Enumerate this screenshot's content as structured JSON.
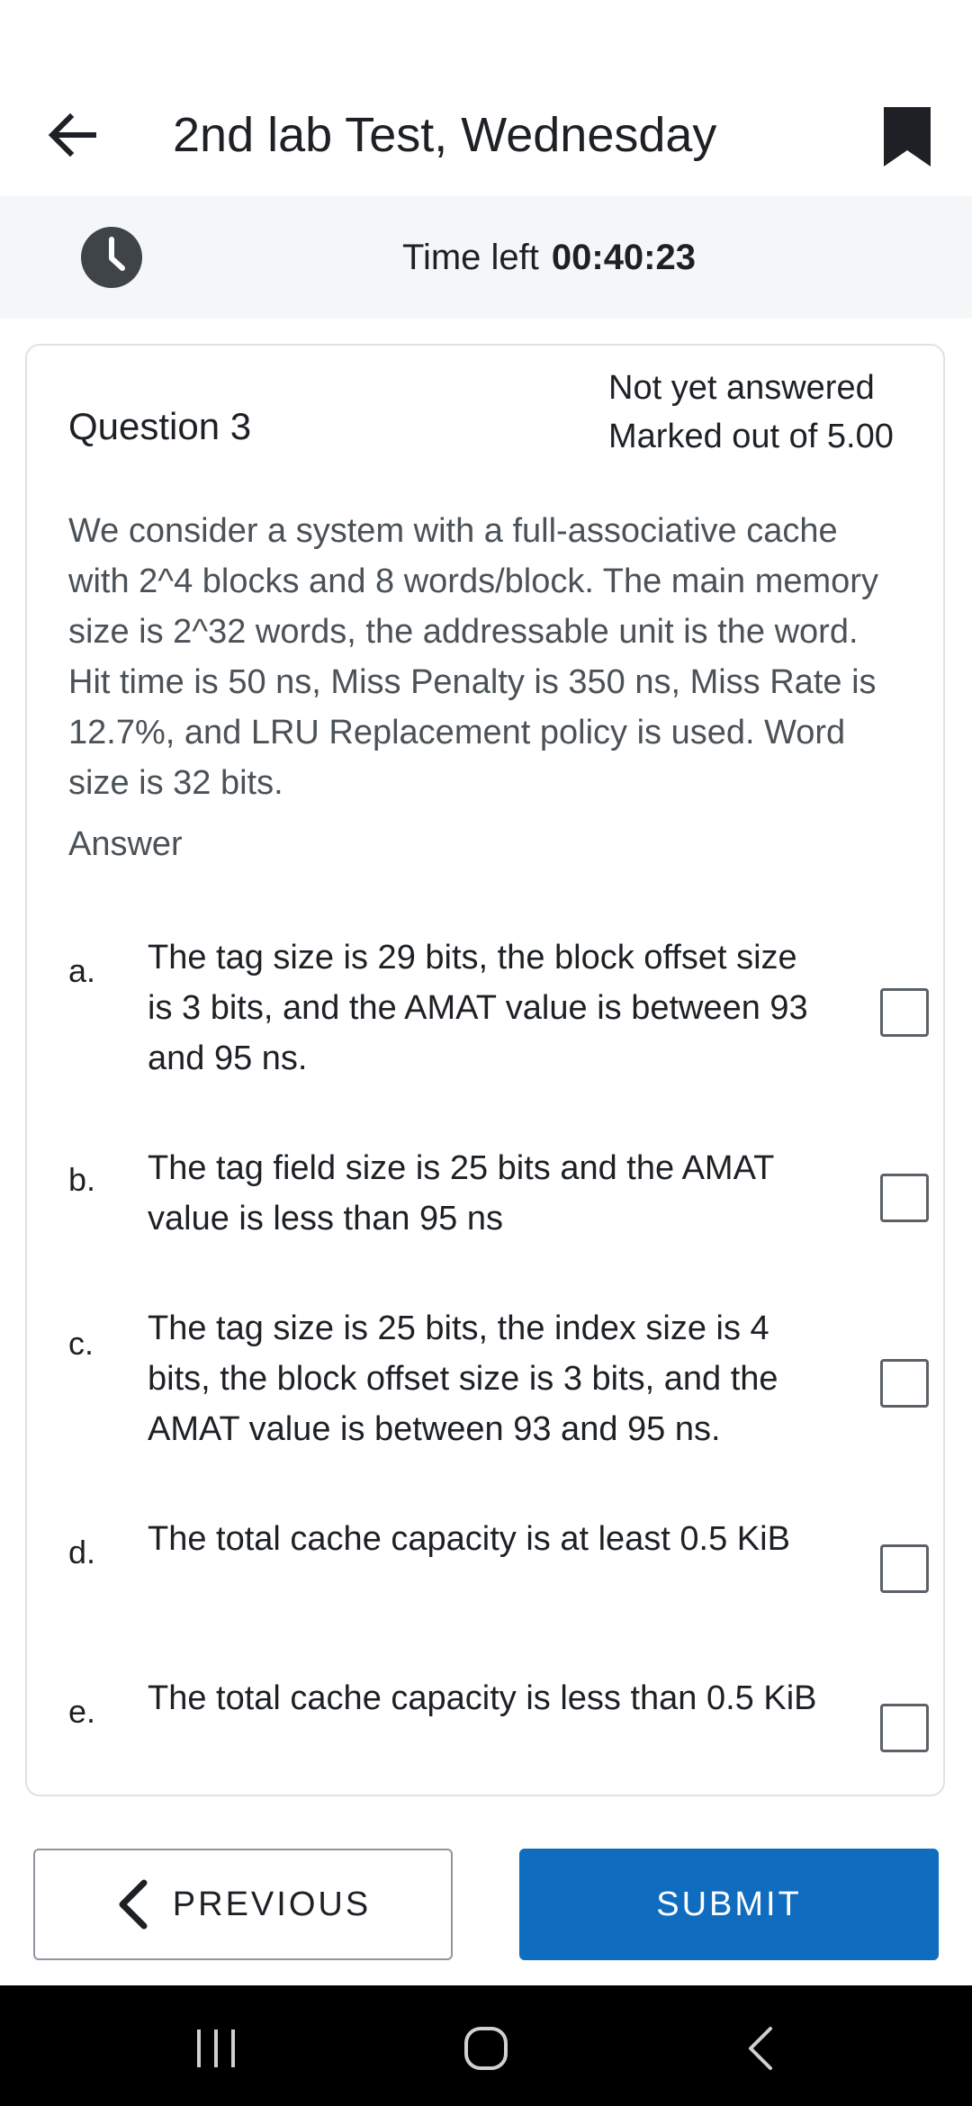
{
  "header": {
    "title": "2nd lab Test, Wednesday",
    "back_icon": "arrow-left-icon",
    "bookmark_icon": "bookmark-icon"
  },
  "timer": {
    "label": "Time left",
    "value": "00:40:23",
    "icon": "clock-icon"
  },
  "question": {
    "number": "Question 3",
    "status_line1": "Not yet answered",
    "status_line2": "Marked out of 5.00",
    "text": "We consider a system with a full-associative cache with 2^4 blocks and 8 words/block. The main memory size is 2^32 words, the addressable unit is the word. Hit time is 50 ns, Miss Penalty is 350 ns, Miss Rate is 12.7%, and LRU Replacement policy is used. Word size is 32 bits.",
    "answer_label": "Answer",
    "options": [
      {
        "letter": "a.",
        "text": "The tag size is 29 bits, the block offset size is 3 bits, and the AMAT value is between 93 and 95 ns.",
        "checked": false
      },
      {
        "letter": "b.",
        "text": "The tag field size is 25 bits and the AMAT value is less than 95 ns",
        "checked": false
      },
      {
        "letter": "c.",
        "text": "The tag size is 25 bits, the index size is 4 bits, the block offset size is 3 bits, and the AMAT value is between 93 and 95 ns.",
        "checked": false
      },
      {
        "letter": "d.",
        "text": "The total cache capacity is at least 0.5 KiB",
        "checked": false
      },
      {
        "letter": "e.",
        "text": "The total cache capacity is less than 0.5 KiB",
        "checked": false
      }
    ]
  },
  "footer": {
    "previous_label": "PREVIOUS",
    "submit_label": "SUBMIT"
  },
  "colors": {
    "primary": "#0f6cbf",
    "text": "#1d2125",
    "muted_text": "#4b5257",
    "timer_bg": "#f5f6f7",
    "card_border": "#dee2e6"
  }
}
